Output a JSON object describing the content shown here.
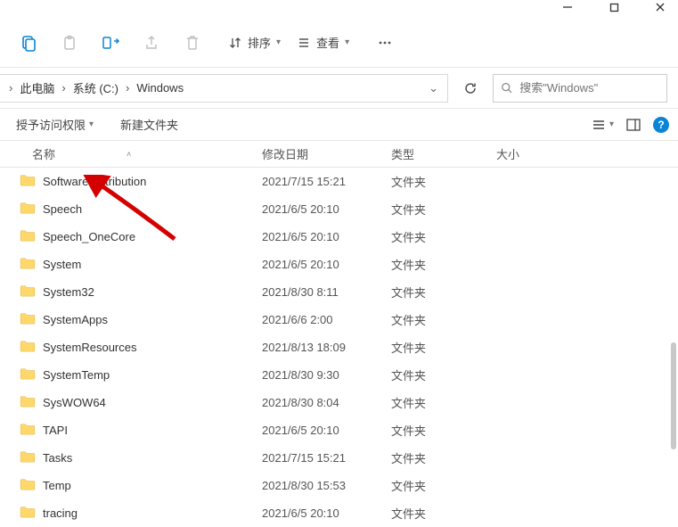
{
  "titlebar": {},
  "toolbar": {
    "sort_label": "排序",
    "view_label": "查看"
  },
  "breadcrumbs": {
    "items": [
      "此电脑",
      "系统 (C:)",
      "Windows"
    ]
  },
  "search": {
    "placeholder": "搜索\"Windows\""
  },
  "cmdbar": {
    "permissions_label": "授予访问权限",
    "newfolder_label": "新建文件夹"
  },
  "columns": {
    "name": "名称",
    "date": "修改日期",
    "type": "类型",
    "size": "大小"
  },
  "rows": [
    {
      "name": "SoftwareDistribution",
      "date": "2021/7/15 15:21",
      "type": "文件夹"
    },
    {
      "name": "Speech",
      "date": "2021/6/5 20:10",
      "type": "文件夹"
    },
    {
      "name": "Speech_OneCore",
      "date": "2021/6/5 20:10",
      "type": "文件夹"
    },
    {
      "name": "System",
      "date": "2021/6/5 20:10",
      "type": "文件夹"
    },
    {
      "name": "System32",
      "date": "2021/8/30 8:11",
      "type": "文件夹"
    },
    {
      "name": "SystemApps",
      "date": "2021/6/6 2:00",
      "type": "文件夹"
    },
    {
      "name": "SystemResources",
      "date": "2021/8/13 18:09",
      "type": "文件夹"
    },
    {
      "name": "SystemTemp",
      "date": "2021/8/30 9:30",
      "type": "文件夹"
    },
    {
      "name": "SysWOW64",
      "date": "2021/8/30 8:04",
      "type": "文件夹"
    },
    {
      "name": "TAPI",
      "date": "2021/6/5 20:10",
      "type": "文件夹"
    },
    {
      "name": "Tasks",
      "date": "2021/7/15 15:21",
      "type": "文件夹"
    },
    {
      "name": "Temp",
      "date": "2021/8/30 15:53",
      "type": "文件夹"
    },
    {
      "name": "tracing",
      "date": "2021/6/5 20:10",
      "type": "文件夹"
    }
  ]
}
